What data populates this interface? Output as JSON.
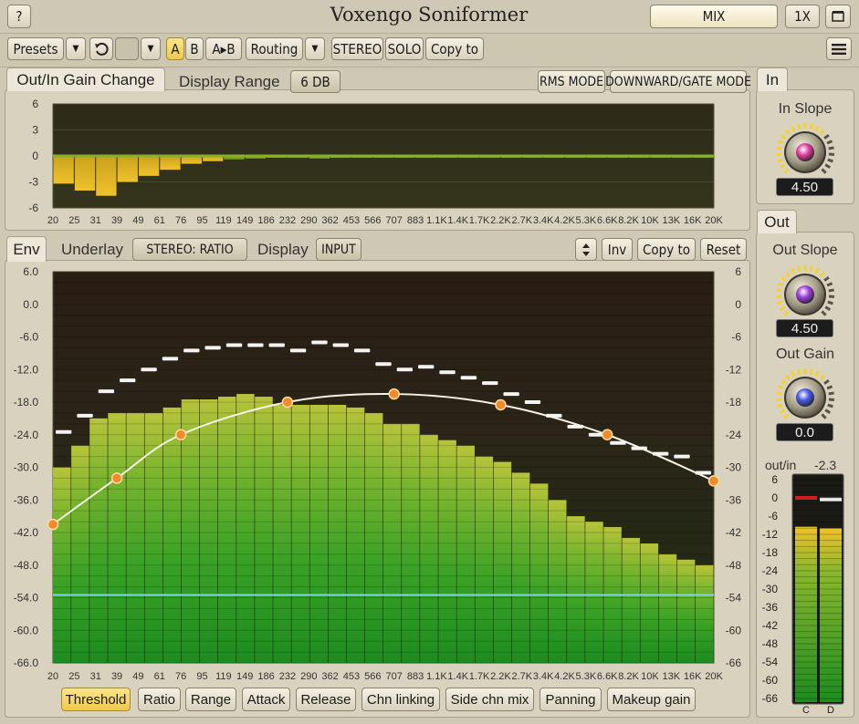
{
  "titlebar": {
    "help_label": "?",
    "title": "Voxengo Soniformer",
    "mix_label": "MIX",
    "zoom_label": "1X",
    "window_icon": "window-restore-icon"
  },
  "toolbar": {
    "presets": "Presets",
    "a": "A",
    "b": "B",
    "ab": "A▸B",
    "routing": "Routing",
    "stereo": "STEREO",
    "solo": "SOLO",
    "copy_to": "Copy to",
    "undo_icon": "undo-icon",
    "menu_icon": "hamburger-menu-icon"
  },
  "gain_panel": {
    "tab": "Out/In Gain Change",
    "display_range_label": "Display Range",
    "display_range_value": "6 DB",
    "rms_mode": "RMS MODE",
    "gate_mode": "DOWNWARD/GATE MODE",
    "y_ticks": [
      "6",
      "3",
      "0",
      "-3",
      "-6"
    ],
    "freq_labels": [
      "20",
      "25",
      "31",
      "39",
      "49",
      "61",
      "76",
      "95",
      "119",
      "149",
      "186",
      "232",
      "290",
      "362",
      "453",
      "566",
      "707",
      "883",
      "1.1K",
      "1.4K",
      "1.7K",
      "2.2K",
      "2.7K",
      "3.4K",
      "4.2K",
      "5.3K",
      "6.6K",
      "8.2K",
      "10K",
      "13K",
      "16K",
      "20K"
    ],
    "gain_db": [
      -3.2,
      -4.0,
      -4.6,
      -3.0,
      -2.3,
      -1.6,
      -0.9,
      -0.6,
      -0.4,
      -0.3,
      -0.2,
      -0.2,
      -0.3,
      -0.1,
      -0.1,
      -0.1,
      -0.1,
      -0.1,
      -0.1,
      -0.1,
      -0.1,
      -0.1,
      -0.1,
      -0.1,
      -0.1,
      -0.1,
      -0.1,
      -0.1,
      -0.1,
      -0.1,
      -0.1
    ]
  },
  "env_panel": {
    "tab": "Env",
    "underlay_label": "Underlay",
    "underlay_value": "STEREO: RATIO",
    "display_label": "Display",
    "display_value": "INPUT",
    "inv": "Inv",
    "copy_to": "Copy to",
    "reset": "Reset",
    "updown_icon": "up-down-arrows-icon",
    "y_ticks_left": [
      "6.0",
      "0.0",
      "-6.0",
      "-12.0",
      "-18.0",
      "-24.0",
      "-30.0",
      "-36.0",
      "-42.0",
      "-48.0",
      "-54.0",
      "-60.0",
      "-66.0"
    ],
    "y_ticks_right": [
      "6",
      "0",
      "-6",
      "-12",
      "-18",
      "-24",
      "-30",
      "-36",
      "-42",
      "-48",
      "-54",
      "-60",
      "-66"
    ],
    "freq_labels": [
      "20",
      "25",
      "31",
      "39",
      "49",
      "61",
      "76",
      "95",
      "119",
      "149",
      "186",
      "232",
      "290",
      "362",
      "453",
      "566",
      "707",
      "883",
      "1.1K",
      "1.4K",
      "1.7K",
      "2.2K",
      "2.7K",
      "3.4K",
      "4.2K",
      "5.3K",
      "6.6K",
      "8.2K",
      "10K",
      "13K",
      "16K",
      "20K"
    ],
    "spectrum_db": [
      -30,
      -26,
      -21,
      -20,
      -20,
      -20,
      -19,
      -17.5,
      -17.5,
      -17,
      -16.5,
      -17,
      -18.5,
      -18.5,
      -18.5,
      -18.5,
      -19,
      -20,
      -22,
      -22,
      -24,
      -25,
      -26,
      -28,
      -29,
      -31,
      -33,
      -36,
      -39,
      -40,
      -41,
      -43,
      -44,
      -46,
      -47,
      -48
    ],
    "peak_db": [
      -23.5,
      -20.5,
      -16,
      -14,
      -12,
      -10,
      -8.5,
      -8,
      -7.5,
      -7.5,
      -7.5,
      -8.5,
      -7,
      -7.5,
      -8.5,
      -11,
      -12,
      -11.5,
      -12.5,
      -13.5,
      -14.5,
      -16.5,
      -18,
      -20.5,
      -22.5,
      -24,
      -25.5,
      -26.5,
      -27.5,
      -28,
      -31
    ],
    "threshold_db": -53.5,
    "curve_points": [
      {
        "freq": "20",
        "db": -40.5
      },
      {
        "freq": "39",
        "db": -32
      },
      {
        "freq": "76",
        "db": -24
      },
      {
        "freq": "232",
        "db": -18
      },
      {
        "freq": "707",
        "db": -16.5
      },
      {
        "freq": "2.2K",
        "db": -18.5
      },
      {
        "freq": "6.6K",
        "db": -24
      },
      {
        "freq": "20K",
        "db": -32.5
      }
    ],
    "tabs": [
      "Threshold",
      "Ratio",
      "Range",
      "Attack",
      "Release",
      "Chn linking",
      "Side chn mix",
      "Panning",
      "Makeup gain"
    ],
    "active_tab": "Threshold"
  },
  "in_panel": {
    "tab": "In",
    "slope_label": "In Slope",
    "slope_value": "4.50",
    "slope_color": "#e040a0"
  },
  "out_panel": {
    "tab": "Out",
    "slope_label": "Out Slope",
    "slope_value": "4.50",
    "slope_color": "#a040e0",
    "gain_label": "Out Gain",
    "gain_value": "0.0",
    "gain_color": "#4a58e8",
    "meter_label": "out/in",
    "meter_value": "-2.3",
    "meter_ticks": [
      "6",
      "0",
      "-6",
      "-12",
      "-18",
      "-24",
      "-30",
      "-36",
      "-42",
      "-48",
      "-54",
      "-60",
      "-66"
    ],
    "meter_channels": [
      "C",
      "D"
    ],
    "meter_levels_db": [
      -9.5,
      -10
    ],
    "meter_peaks_db": [
      0,
      -0.5
    ]
  }
}
